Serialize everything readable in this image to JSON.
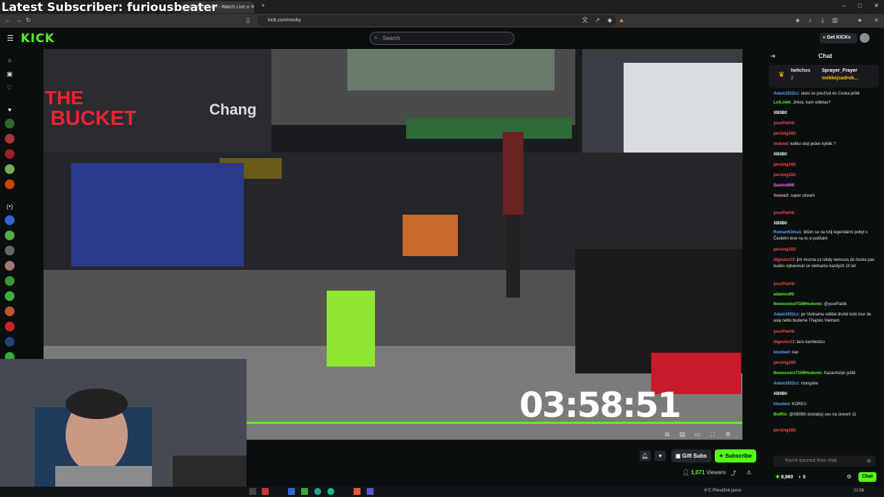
{
  "overlay": {
    "text": "Latest Subscriber: furiousbeater"
  },
  "browser": {
    "tab_title": "Novby Stream - Watch Live o",
    "url": "kick.com/novby"
  },
  "kick": {
    "logo": "KICK",
    "search_placeholder": "Search",
    "get_kicks": "Get KICKs"
  },
  "stream": {
    "timer": "03:58:51",
    "gift_subs": "Gift Subs",
    "subscribe": "Subscribe",
    "viewers": "1,071",
    "viewers_label": "Viewers"
  },
  "chat": {
    "title": "Chat",
    "pinned_user": "twitchos",
    "pinned_count": "2",
    "pinned_gifters": [
      "Sprayer_Frayer",
      "mekkejsadrok..."
    ],
    "input_placeholder": "You're banned from chat",
    "chat_button": "Chat",
    "points": "8,980",
    "zero": "0",
    "messages": [
      {
        "user": "Adam1922cz",
        "text": "ukdo se používá do Česka ještě",
        "color": "#5aa9ff"
      },
      {
        "user": "LolLolek",
        "text": "Jirkos, kam odletas?",
        "color": "#53fc18"
      },
      {
        "user": "XB0B0",
        "text": "",
        "color": "#ffffff"
      },
      {
        "user": "yourPatrik",
        "text": "",
        "color": "#ff4b4b"
      },
      {
        "user": "persing182",
        "text": "",
        "color": "#ff4b4b"
      },
      {
        "user": "mokmil",
        "text": "koliko stoji jeden kyblik ?",
        "color": "#ff4b4b"
      },
      {
        "user": "XB0B0",
        "text": "",
        "color": "#ffffff"
      },
      {
        "user": "persing182",
        "text": "",
        "color": "#ff4b4b"
      },
      {
        "user": "persing182",
        "text": "",
        "color": "#ff4b4b"
      },
      {
        "user": "Saulos666",
        "text": "",
        "color": "#ff6aff"
      },
      {
        "user": "Susne3",
        "text": "super stream",
        "color": "#ff9ec7"
      },
      {
        "user": "yourPatrik",
        "text": "",
        "color": "#ff4b4b"
      },
      {
        "user": "XB0B0",
        "text": "",
        "color": "#ffffff"
      },
      {
        "user": "RomanKlima1",
        "text": "těším se na tvůj legendární pobyt v Českém lese na to si počkám",
        "color": "#5aa9ff"
      },
      {
        "user": "persing182",
        "text": "",
        "color": "#ff4b4b"
      },
      {
        "user": "digestor23",
        "text": "jirir mozna uz nikdy nemusis do česka pas budes vybavovat ve vietnamu kazdych 10 let",
        "color": "#ff4b4b"
      },
      {
        "user": "yourPatrik",
        "text": "",
        "color": "#ff4b4b"
      },
      {
        "user": "adamos99",
        "text": "",
        "color": "#53fc18"
      },
      {
        "user": "NemocniceTGMHodonin",
        "text": "@yourPatrik",
        "color": "#53fc18"
      },
      {
        "user": "Adam1922cz",
        "text": "po Vietnamu udělat druhé kolo tour de asia nebo budeme Thajsko Vietnam",
        "color": "#5aa9ff"
      },
      {
        "user": "yourPatrik",
        "text": "",
        "color": "#ff4b4b"
      },
      {
        "user": "digestor23",
        "text": "laos kambodzu",
        "color": "#ff4b4b"
      },
      {
        "user": "kloobed",
        "text": "iran",
        "color": "#5aa9ff"
      },
      {
        "user": "persing182",
        "text": "",
        "color": "#ff4b4b"
      },
      {
        "user": "NemocniceTGMHodonin",
        "text": "Kazachstán ještě",
        "color": "#53fc18"
      },
      {
        "user": "Adam1922cz",
        "text": "mongolia",
        "color": "#5aa9ff"
      },
      {
        "user": "XB0B0",
        "text": "",
        "color": "#ffffff"
      },
      {
        "user": "kloobed",
        "text": "KOREU",
        "color": "#5aa9ff"
      },
      {
        "user": "BotRix",
        "text": "@XB0B0 dostal(a) ses na úroveň 11",
        "color": "#53fc18"
      },
      {
        "user": "persing182",
        "text": "",
        "color": "#ff4b4b"
      }
    ]
  },
  "taskbar": {
    "weather": "6°C Převážně jasno",
    "clock": "21:58"
  },
  "colors": {
    "accent": "#53fc18",
    "background": "#0b0e0f"
  }
}
